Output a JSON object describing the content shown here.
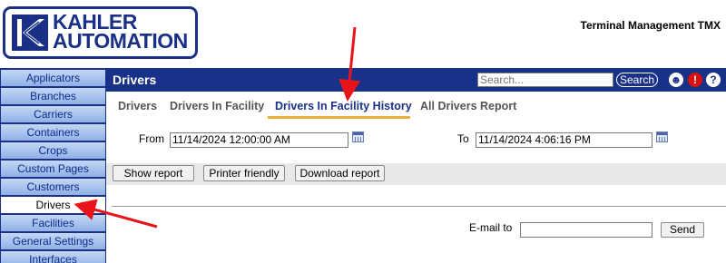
{
  "logo": {
    "line1": "KAHLER",
    "line2": "AUTOMATION"
  },
  "app_title": "Terminal Management TMX",
  "sidebar": {
    "items": [
      {
        "label": "Applicators"
      },
      {
        "label": "Branches"
      },
      {
        "label": "Carriers"
      },
      {
        "label": "Containers"
      },
      {
        "label": "Crops"
      },
      {
        "label": "Custom Pages"
      },
      {
        "label": "Customers"
      },
      {
        "label": "Drivers",
        "active": true
      },
      {
        "label": "Facilities"
      },
      {
        "label": "General Settings"
      },
      {
        "label": "Interfaces"
      }
    ]
  },
  "header": {
    "title": "Drivers",
    "search_placeholder": "Search...",
    "search_button": "Search",
    "icons": [
      "user-icon",
      "alert-icon",
      "help-icon"
    ]
  },
  "tabs": [
    {
      "label": "Drivers"
    },
    {
      "label": "Drivers In Facility"
    },
    {
      "label": "Drivers In Facility History",
      "active": true
    },
    {
      "label": "All Drivers Report"
    }
  ],
  "filters": {
    "from_label": "From",
    "from_value": "11/14/2024 12:00:00 AM",
    "to_label": "To",
    "to_value": "11/14/2024 4:06:16 PM"
  },
  "buttons": {
    "show_report": "Show report",
    "printer_friendly": "Printer friendly",
    "download_report": "Download report"
  },
  "email": {
    "label": "E-mail to",
    "value": "",
    "send": "Send"
  },
  "colors": {
    "navy": "#1a3189",
    "tab_underline": "#e8b13a",
    "alert": "#d91010",
    "arrow": "#e8141a"
  }
}
